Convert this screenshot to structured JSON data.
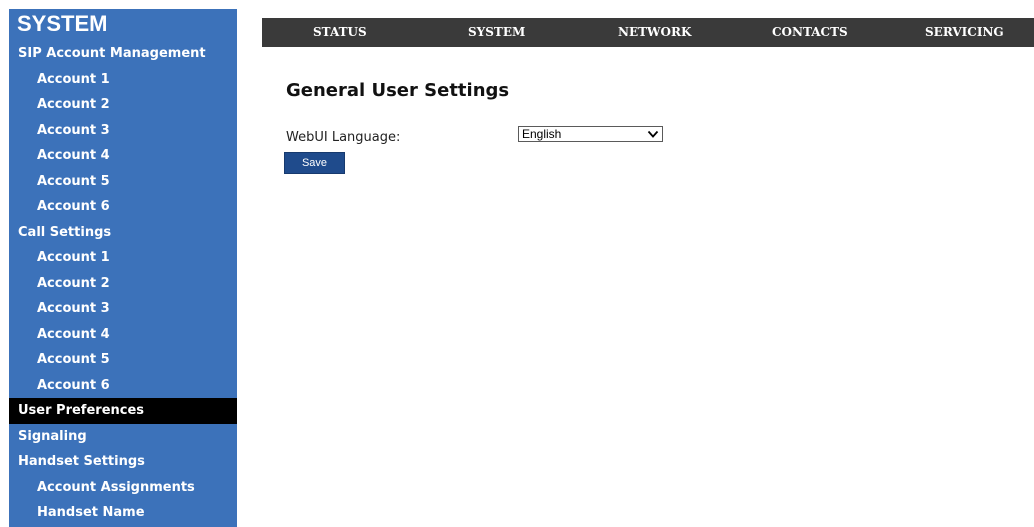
{
  "sidebar": {
    "title": "SYSTEM",
    "items": [
      {
        "label": "SIP Account Management"
      },
      {
        "label": "Account 1"
      },
      {
        "label": "Account 2"
      },
      {
        "label": "Account 3"
      },
      {
        "label": "Account 4"
      },
      {
        "label": "Account 5"
      },
      {
        "label": "Account 6"
      },
      {
        "label": "Call Settings"
      },
      {
        "label": "Account 1"
      },
      {
        "label": "Account 2"
      },
      {
        "label": "Account 3"
      },
      {
        "label": "Account 4"
      },
      {
        "label": "Account 5"
      },
      {
        "label": "Account 6"
      },
      {
        "label": "User Preferences"
      },
      {
        "label": "Signaling"
      },
      {
        "label": "Handset Settings"
      },
      {
        "label": "Account Assignments"
      },
      {
        "label": "Handset Name"
      }
    ],
    "active_item": "User Preferences"
  },
  "topnav": {
    "items": [
      {
        "label": "STATUS"
      },
      {
        "label": "SYSTEM"
      },
      {
        "label": "NETWORK"
      },
      {
        "label": "CONTACTS"
      },
      {
        "label": "SERVICING"
      }
    ]
  },
  "main": {
    "title": "General User Settings",
    "language_label": "WebUI Language:",
    "language_value": "English",
    "save_label": "Save"
  },
  "icons": {
    "select_chevron": "chevron-down-icon"
  },
  "colors": {
    "sidebar_bg": "#3c72ba",
    "active_bg": "#000000",
    "topnav_bg": "#3a3a3a",
    "button_bg": "#1f4b8c"
  }
}
